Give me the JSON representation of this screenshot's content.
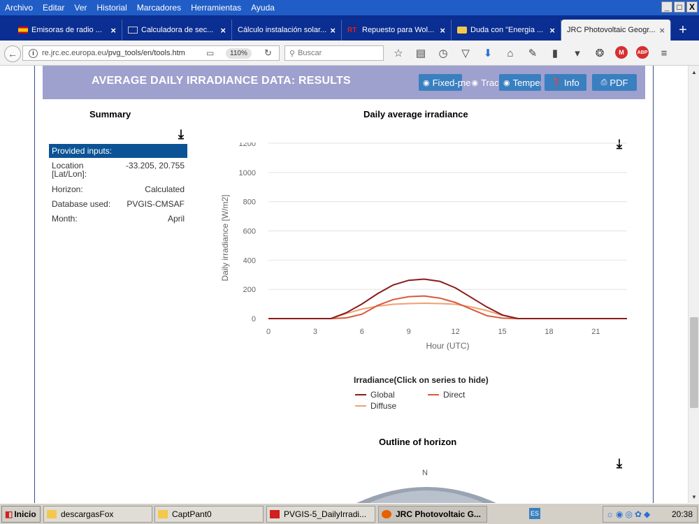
{
  "menubar": {
    "items": [
      "Archivo",
      "Editar",
      "Ver",
      "Historial",
      "Marcadores",
      "Herramientas",
      "Ayuda"
    ],
    "window_buttons": [
      "_",
      "□",
      "X"
    ]
  },
  "tabs": [
    {
      "label": "Emisoras de radio ...",
      "icon": "flag-es-icon",
      "icon_color": "#c60b1e"
    },
    {
      "label": "Calculadora de sec...",
      "icon": "calc-icon",
      "icon_color": "#ffffff"
    },
    {
      "label": "Cálculo instalación solar...",
      "icon": "page-icon",
      "icon_color": "#ffffff"
    },
    {
      "label": "Repuesto para Wol...",
      "icon": "rt-icon",
      "icon_color": "#e02020"
    },
    {
      "label": "Duda con \"Energia ...",
      "icon": "folder-icon",
      "icon_color": "#f2c94c"
    },
    {
      "label": "JRC Photovoltaic Geogr...",
      "icon": "jrc-icon",
      "icon_color": "#ffffff",
      "active": true
    }
  ],
  "newtab": "+",
  "nav": {
    "url_host": "re.jrc.ec.europa.eu",
    "url_path": "/pvg_tools/en/tools.htm",
    "zoom": "110%",
    "search_placeholder": "Buscar"
  },
  "banner": {
    "title": "AVERAGE DAILY IRRADIANCE DATA: RESULTS",
    "buttons": [
      "Fixed-plane",
      "Tracking",
      "Temperature",
      "Info",
      "PDF"
    ],
    "button_visible_text": {
      "fixed": "Fixed-p",
      "overlap": "ne",
      "tracking": "Tracki",
      "temperature": "Temper",
      "info": "Info",
      "pdf": "PDF"
    }
  },
  "summary": {
    "title": "Summary",
    "header": "Provided inputs:",
    "rows": [
      {
        "key": "Location",
        "key2": "[Lat/Lon]:",
        "value": "-33.205, 20.755"
      },
      {
        "key": "Horizon:",
        "value": "Calculated"
      },
      {
        "key": "Database used:",
        "value": "PVGIS-CMSAF"
      },
      {
        "key": "Month:",
        "value": "April"
      }
    ]
  },
  "chart_title": "Daily average irradiance",
  "chart_data": {
    "type": "line",
    "title": "Daily average irradiance",
    "xlabel": "Hour (UTC)",
    "ylabel": "Daily irradiance [W/m2]",
    "xlim": [
      0,
      23
    ],
    "ylim": [
      0,
      1200
    ],
    "xticks": [
      0,
      3,
      6,
      9,
      12,
      15,
      18,
      21
    ],
    "yticks": [
      0,
      200,
      400,
      600,
      800,
      1000,
      1200
    ],
    "grid": true,
    "legend_title": "Irradiance(Click on series to hide)",
    "legend_position": "bottom",
    "x": [
      0,
      1,
      2,
      3,
      4,
      5,
      6,
      7,
      8,
      9,
      10,
      11,
      12,
      13,
      14,
      15,
      16,
      17,
      18,
      19,
      20,
      21,
      22,
      23
    ],
    "series": [
      {
        "name": "Global",
        "color": "#8b1a1a",
        "values": [
          0,
          0,
          0,
          0,
          0,
          40,
          100,
          170,
          230,
          262,
          270,
          255,
          210,
          145,
          80,
          25,
          0,
          0,
          0,
          0,
          0,
          0,
          0,
          0
        ]
      },
      {
        "name": "Direct",
        "color": "#d9593a",
        "values": [
          0,
          0,
          0,
          0,
          0,
          5,
          30,
          90,
          130,
          150,
          155,
          140,
          110,
          65,
          20,
          3,
          0,
          0,
          0,
          0,
          0,
          0,
          0,
          0
        ]
      },
      {
        "name": "Diffuse",
        "color": "#f0a070",
        "values": [
          0,
          0,
          0,
          0,
          0,
          35,
          65,
          85,
          98,
          103,
          105,
          103,
          98,
          80,
          55,
          22,
          0,
          0,
          0,
          0,
          0,
          0,
          0,
          0
        ]
      }
    ]
  },
  "horizon": {
    "title": "Outline of horizon",
    "north_label": "N"
  },
  "taskbar": {
    "start": "Inicio",
    "buttons": [
      "descargasFox",
      "CaptPant0",
      "PVGIS-5_DailyIrradi...",
      "JRC Photovoltaic G..."
    ],
    "lang": "ES",
    "clock": "20:38"
  }
}
